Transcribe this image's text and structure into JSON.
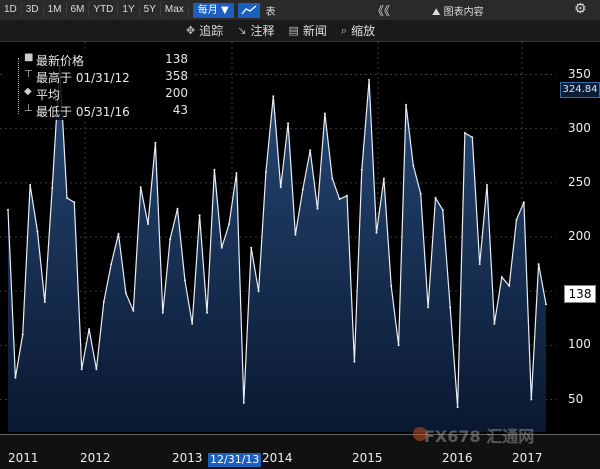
{
  "toolbar": {
    "ranges": [
      "1D",
      "3D",
      "1M",
      "6M",
      "YTD",
      "1Y",
      "5Y",
      "Max"
    ],
    "frequency": "每月 ▼",
    "table_label": "表",
    "collapse": "《《",
    "legend_toggle": "图表内容",
    "settings": "⚙"
  },
  "tools": [
    {
      "icon": "✥",
      "label": "追踪"
    },
    {
      "icon": "↘",
      "label": "注释"
    },
    {
      "icon": "▤",
      "label": "新闻"
    },
    {
      "icon": "⌕",
      "label": "缩放"
    }
  ],
  "legend": {
    "rows": [
      {
        "symbol": "■",
        "label": "最新价格",
        "value": "138"
      },
      {
        "symbol": "⊤",
        "label": "最高于 01/31/12",
        "value": "358"
      },
      {
        "symbol": "◆",
        "label": "平均",
        "value": "200"
      },
      {
        "symbol": "⊥",
        "label": "最低于 05/31/16",
        "value": "43"
      }
    ]
  },
  "badges": {
    "last": "138",
    "high": "324.84"
  },
  "cursor_date": "12/31/13",
  "watermark": "FX678 汇通网",
  "colors": {
    "line": "#e8eef7",
    "fill_top": "#274a78",
    "fill_bottom": "#0a1830",
    "grid": "#3a3a3a",
    "accent": "#1d5fbf"
  },
  "chart_data": {
    "type": "area",
    "title": "",
    "xlabel": "",
    "ylabel": "",
    "ylim": [
      20,
      380
    ],
    "yticks": [
      50,
      100,
      150,
      200,
      250,
      300,
      350
    ],
    "x_ticks": [
      "2011",
      "2012",
      "2013",
      "2014",
      "2015",
      "2016",
      "2017"
    ],
    "grid": true,
    "legend_position": "top-left",
    "series": [
      {
        "values": [
          225,
          70,
          110,
          248,
          205,
          140,
          245,
          358,
          236,
          232,
          78,
          115,
          78,
          140,
          175,
          203,
          148,
          132,
          246,
          212,
          287,
          130,
          198,
          226,
          160,
          120,
          220,
          130,
          262,
          190,
          212,
          259,
          47,
          190,
          150,
          260,
          330,
          246,
          305,
          202,
          244,
          280,
          226,
          314,
          254,
          235,
          238,
          85,
          262,
          345,
          204,
          254,
          155,
          100,
          322,
          266,
          240,
          135,
          236,
          225,
          135,
          43,
          296,
          292,
          175,
          248,
          120,
          163,
          155,
          216,
          232,
          50,
          175,
          138
        ]
      }
    ]
  }
}
